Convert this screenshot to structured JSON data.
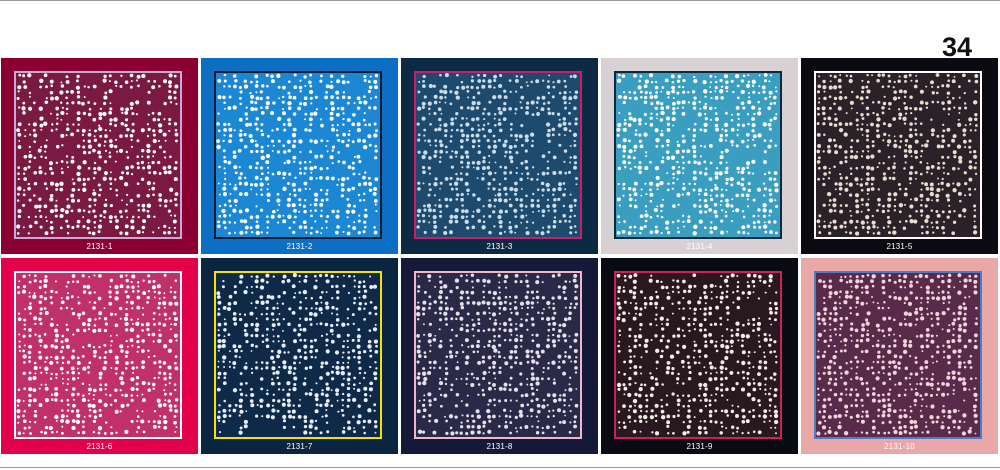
{
  "page": {
    "number": "34"
  },
  "swatches": [
    {
      "code": "2131-1",
      "border": "#8a0033",
      "inner": "#7a1a40",
      "dot": "#ffffff",
      "frame": "#c9a9d6",
      "label_color": "#ffffff"
    },
    {
      "code": "2131-2",
      "border": "#0d6fc4",
      "inner": "#1c88d4",
      "dot": "#ffffff",
      "frame": "#0a1830",
      "label_color": "#ffffff"
    },
    {
      "code": "2131-3",
      "border": "#0d2a45",
      "inner": "#1e4a6e",
      "dot": "#c9dcea",
      "frame": "#d01b6a",
      "label_color": "#ffffff"
    },
    {
      "code": "2131-4",
      "border": "#d8d1d3",
      "inner": "#3a9ec0",
      "dot": "#ffffff",
      "frame": "#0a2a40",
      "label_color": "#ffffff"
    },
    {
      "code": "2131-5",
      "border": "#0a0a10",
      "inner": "#2a2228",
      "dot": "#e8dcd0",
      "frame": "#ffffff",
      "label_color": "#ffffff"
    },
    {
      "code": "2131-6",
      "border": "#e3004a",
      "inner": "#c0306a",
      "dot": "#ffffff",
      "frame": "#ffffff",
      "label_color": "#ffffff"
    },
    {
      "code": "2131-7",
      "border": "#0b2440",
      "inner": "#0e2a48",
      "dot": "#e8eef5",
      "frame": "#f2e400",
      "label_color": "#ffffff"
    },
    {
      "code": "2131-8",
      "border": "#141a38",
      "inner": "#2a2a48",
      "dot": "#e6dfe8",
      "frame": "#f0b7c8",
      "label_color": "#ffffff"
    },
    {
      "code": "2131-9",
      "border": "#0a0a12",
      "inner": "#2a1820",
      "dot": "#f2ece6",
      "frame": "#d0205a",
      "label_color": "#ffffff"
    },
    {
      "code": "2131-10",
      "border": "#eaa7a7",
      "inner": "#5a2a4a",
      "dot": "#f0d4dc",
      "frame": "#4a7fc8",
      "label_color": "#ffffff"
    }
  ]
}
